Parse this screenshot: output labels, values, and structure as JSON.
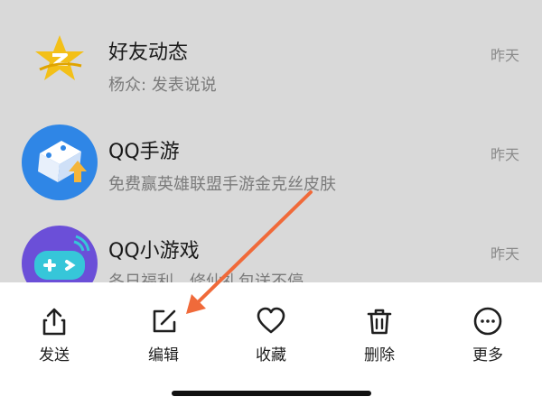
{
  "chats": [
    {
      "title": "好友动态",
      "subtitle": "杨众: 发表说说",
      "time": "昨天",
      "icon": "qzone-star-icon"
    },
    {
      "title": "QQ手游",
      "subtitle": "免费赢英雄联盟手游金克丝皮肤",
      "time": "昨天",
      "icon": "qq-mobile-games-icon"
    },
    {
      "title": "QQ小游戏",
      "subtitle": "冬日福利，修仙礼包送不停",
      "time": "昨天",
      "icon": "gamepad-icon"
    }
  ],
  "toolbar": {
    "send": {
      "label": "发送",
      "icon": "share-icon"
    },
    "edit": {
      "label": "编辑",
      "icon": "edit-icon"
    },
    "favorite": {
      "label": "收藏",
      "icon": "heart-icon"
    },
    "delete": {
      "label": "删除",
      "icon": "trash-icon"
    },
    "more": {
      "label": "更多",
      "icon": "more-icon"
    }
  },
  "colors": {
    "overlay_background": "#d9d9d9",
    "annotation_arrow": "#f06a3a",
    "qzone_star": "#f3c018",
    "games_blue": "#2f86e6"
  }
}
